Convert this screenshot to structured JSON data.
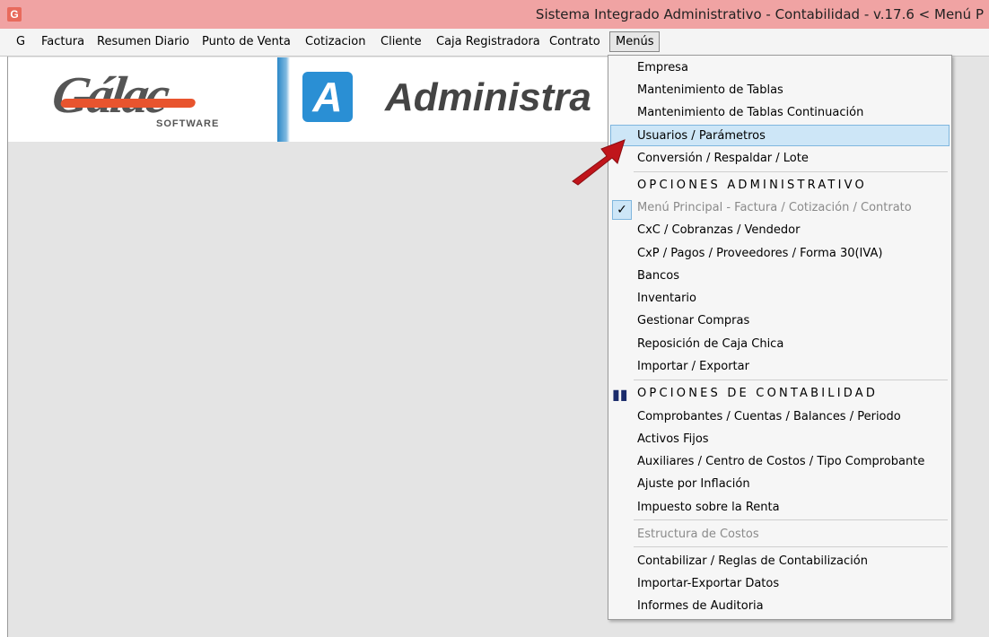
{
  "window": {
    "title": "Sistema Integrado Administrativo - Contabilidad - v.17.6 < Menú P",
    "icon": "app-g-icon"
  },
  "menubar": [
    "G",
    "Factura",
    "Resumen Diario",
    "Punto de Venta",
    "Cotizacion",
    "Cliente",
    "Caja Registradora",
    "Contrato",
    "Menús"
  ],
  "banner": {
    "brand": "Gálac",
    "brand_sub": "SOFTWARE",
    "badge": "A",
    "product": "Administra"
  },
  "dropdown": {
    "items": [
      "Empresa",
      "Mantenimiento de Tablas",
      "Mantenimiento de Tablas Continuación",
      "Usuarios / Parámetros",
      "Conversión / Respaldar / Lote",
      "OPCIONES ADMINISTRATIVO",
      "Menú Principal - Factura / Cotización / Contrato",
      "CxC / Cobranzas / Vendedor",
      "CxP / Pagos / Proveedores / Forma 30(IVA)",
      "Bancos",
      "Inventario",
      "Gestionar Compras",
      "Reposición de Caja Chica",
      "Importar / Exportar",
      "OPCIONES DE CONTABILIDAD",
      "Comprobantes / Cuentas / Balances / Periodo",
      "Activos Fijos",
      "Auxiliares / Centro de Costos / Tipo Comprobante",
      "Ajuste por Inflación",
      "Impuesto sobre la Renta",
      "Estructura de Costos",
      "Contabilizar / Reglas de Contabilización",
      "Importar-Exportar Datos",
      "Informes de Auditoria"
    ],
    "highlighted": "Usuarios / Parámetros",
    "checked": "Menú Principal - Factura / Cotización / Contrato"
  },
  "colors": {
    "titlebar": "#f0a3a3",
    "highlight": "#cde6f7",
    "arrow": "#c0151b"
  }
}
